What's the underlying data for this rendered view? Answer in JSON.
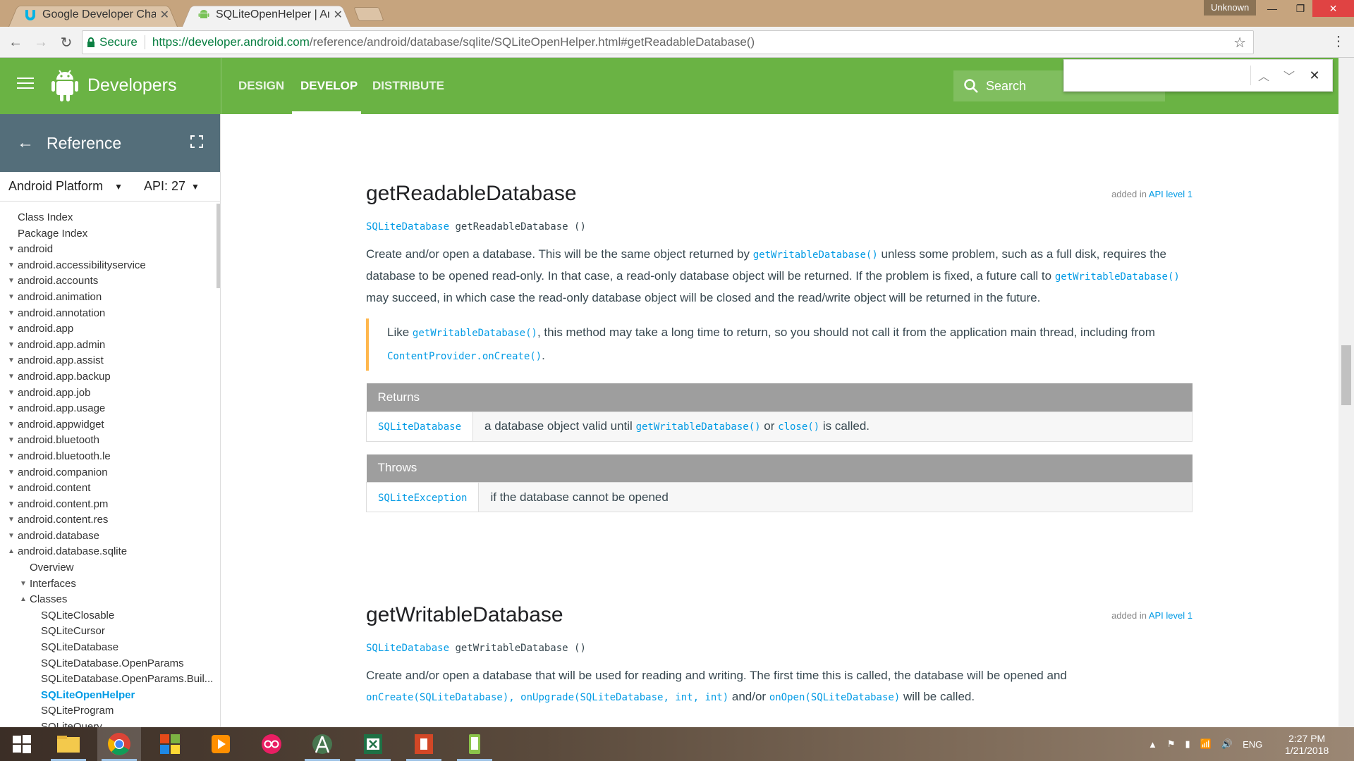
{
  "browser": {
    "tabs": [
      {
        "label": "Google Developer Challe",
        "icon": "udacity-icon",
        "active": false
      },
      {
        "label": "SQLiteOpenHelper | And",
        "icon": "android-icon",
        "active": true
      }
    ],
    "profile": "Unknown",
    "secure_label": "Secure",
    "url_scheme_host": "https://developer.android.com",
    "url_path": "/reference/android/database/sqlite/SQLiteOpenHelper.html#getReadableDatabase()"
  },
  "site": {
    "brand": "Developers",
    "nav": [
      {
        "label": "DESIGN",
        "active": false
      },
      {
        "label": "DEVELOP",
        "active": true
      },
      {
        "label": "DISTRIBUTE",
        "active": false
      }
    ],
    "search_label": "Search",
    "accent": "#6ab344"
  },
  "find_bar": {
    "value": ""
  },
  "sidebar": {
    "title": "Reference",
    "platform": "Android Platform",
    "api": "API: 27",
    "items": [
      {
        "label": "Class Index",
        "indent": 0,
        "chev": ""
      },
      {
        "label": "Package Index",
        "indent": 0,
        "chev": ""
      },
      {
        "label": "android",
        "indent": 0,
        "chev": "down"
      },
      {
        "label": "android.accessibilityservice",
        "indent": 0,
        "chev": "down"
      },
      {
        "label": "android.accounts",
        "indent": 0,
        "chev": "down"
      },
      {
        "label": "android.animation",
        "indent": 0,
        "chev": "down"
      },
      {
        "label": "android.annotation",
        "indent": 0,
        "chev": "down"
      },
      {
        "label": "android.app",
        "indent": 0,
        "chev": "down"
      },
      {
        "label": "android.app.admin",
        "indent": 0,
        "chev": "down"
      },
      {
        "label": "android.app.assist",
        "indent": 0,
        "chev": "down"
      },
      {
        "label": "android.app.backup",
        "indent": 0,
        "chev": "down"
      },
      {
        "label": "android.app.job",
        "indent": 0,
        "chev": "down"
      },
      {
        "label": "android.app.usage",
        "indent": 0,
        "chev": "down"
      },
      {
        "label": "android.appwidget",
        "indent": 0,
        "chev": "down"
      },
      {
        "label": "android.bluetooth",
        "indent": 0,
        "chev": "down"
      },
      {
        "label": "android.bluetooth.le",
        "indent": 0,
        "chev": "down"
      },
      {
        "label": "android.companion",
        "indent": 0,
        "chev": "down"
      },
      {
        "label": "android.content",
        "indent": 0,
        "chev": "down"
      },
      {
        "label": "android.content.pm",
        "indent": 0,
        "chev": "down"
      },
      {
        "label": "android.content.res",
        "indent": 0,
        "chev": "down"
      },
      {
        "label": "android.database",
        "indent": 0,
        "chev": "down"
      },
      {
        "label": "android.database.sqlite",
        "indent": 0,
        "chev": "up"
      },
      {
        "label": "Overview",
        "indent": 1,
        "chev": ""
      },
      {
        "label": "Interfaces",
        "indent": 1,
        "chev": "down"
      },
      {
        "label": "Classes",
        "indent": 1,
        "chev": "up"
      },
      {
        "label": "SQLiteClosable",
        "indent": 2,
        "chev": ""
      },
      {
        "label": "SQLiteCursor",
        "indent": 2,
        "chev": ""
      },
      {
        "label": "SQLiteDatabase",
        "indent": 2,
        "chev": ""
      },
      {
        "label": "SQLiteDatabase.OpenParams",
        "indent": 2,
        "chev": ""
      },
      {
        "label": "SQLiteDatabase.OpenParams.Buil...",
        "indent": 2,
        "chev": ""
      },
      {
        "label": "SQLiteOpenHelper",
        "indent": 2,
        "chev": "",
        "selected": true
      },
      {
        "label": "SQLiteProgram",
        "indent": 2,
        "chev": ""
      },
      {
        "label": "SQLiteQuery",
        "indent": 2,
        "chev": ""
      }
    ]
  },
  "content": {
    "readable": {
      "title": "getReadableDatabase",
      "added_prefix": "added in ",
      "added_level": "API level 1",
      "sig_type": "SQLiteDatabase",
      "sig_rest": " getReadableDatabase ()",
      "desc_1": "Create and/or open a database. This will be the same object returned by ",
      "desc_link_1": "getWritableDatabase()",
      "desc_2": " unless some problem, such as a full disk, requires the database to be opened read-only. In that case, a read-only database object will be returned. If the problem is fixed, a future call to ",
      "desc_link_2": "getWritableDatabase()",
      "desc_3": " may succeed, in which case the read-only database object will be closed and the read/write object will be returned in the future.",
      "note_1": "Like ",
      "note_link_1": "getWritableDatabase()",
      "note_2": ", this method may take a long time to return, so you should not call it from the application main thread, including from ",
      "note_link_2": "ContentProvider.onCreate()",
      "note_3": ".",
      "returns_header": "Returns",
      "returns_type": "SQLiteDatabase",
      "returns_1": "a database object valid until ",
      "returns_link_1": "getWritableDatabase()",
      "returns_2": " or ",
      "returns_link_2": "close()",
      "returns_3": " is called.",
      "throws_header": "Throws",
      "throws_type": "SQLiteException",
      "throws_desc": "if the database cannot be opened"
    },
    "writable": {
      "title": "getWritableDatabase",
      "added_prefix": "added in ",
      "added_level": "API level 1",
      "sig_type": "SQLiteDatabase",
      "sig_rest": " getWritableDatabase ()",
      "desc_1": "Create and/or open a database that will be used for reading and writing. The first time this is called, the database will be opened and ",
      "desc_link_1": "onCreate(SQLiteDatabase)",
      "desc_2": ", ",
      "desc_link_2": "onUpgrade(SQLiteDatabase, int, int)",
      "desc_3": " and/or ",
      "desc_link_3": "onOpen(SQLiteDatabase)",
      "desc_4": " will be called."
    }
  },
  "taskbar": {
    "apps": [
      "windows-start-icon",
      "file-explorer-icon",
      "chrome-icon",
      "office-icon",
      "media-player-icon",
      "flickr-icon",
      "android-studio-icon",
      "excel-icon",
      "powerpoint-icon",
      "phone-icon"
    ],
    "language": "ENG",
    "time": "2:27 PM",
    "date": "1/21/2018"
  }
}
